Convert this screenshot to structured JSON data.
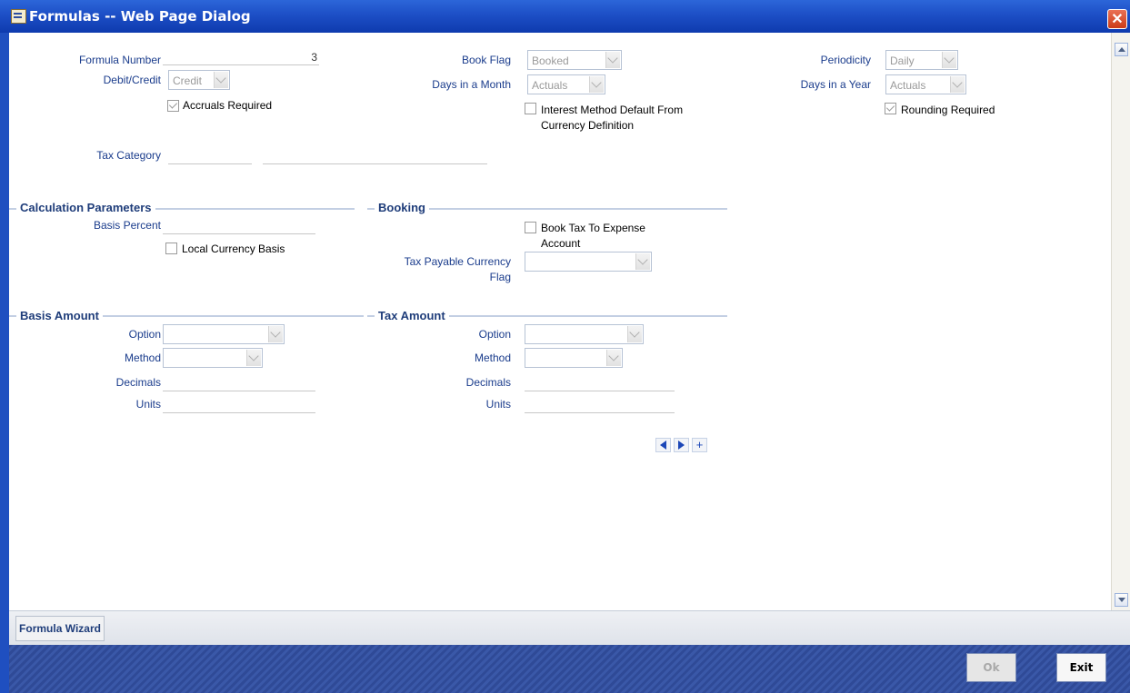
{
  "window": {
    "title": "Formulas -- Web Page Dialog",
    "close_glyph": "✕"
  },
  "fields": {
    "formula_number": {
      "label": "Formula Number",
      "value": "3"
    },
    "debit_credit": {
      "label": "Debit/Credit",
      "value": "Credit"
    },
    "accruals_required": {
      "label": "Accruals Required",
      "checked": true
    },
    "book_flag": {
      "label": "Book Flag",
      "value": "Booked"
    },
    "days_in_month": {
      "label": "Days in a Month",
      "value": "Actuals"
    },
    "interest_method_default": {
      "label_line1": "Interest Method Default From",
      "label_line2": "Currency Definition",
      "checked": false
    },
    "periodicity": {
      "label": "Periodicity",
      "value": "Daily"
    },
    "days_in_year": {
      "label": "Days in a Year",
      "value": "Actuals"
    },
    "rounding_required": {
      "label": "Rounding Required",
      "checked": true
    },
    "tax_category": {
      "label": "Tax Category",
      "value": "",
      "description": ""
    }
  },
  "calculation_parameters": {
    "heading": "Calculation Parameters",
    "basis_percent": {
      "label": "Basis Percent",
      "value": ""
    },
    "local_currency_basis": {
      "label": "Local Currency Basis",
      "checked": false
    }
  },
  "booking": {
    "heading": "Booking",
    "book_tax_to_expense": {
      "label_line1": "Book Tax To Expense",
      "label_line2": "Account",
      "checked": false
    },
    "tax_payable_currency_flag": {
      "label_line1": "Tax Payable Currency",
      "label_line2": "Flag",
      "value": ""
    }
  },
  "basis_amount": {
    "heading": "Basis Amount",
    "option_label": "Option",
    "option_value": "",
    "method_label": "Method",
    "method_value": "",
    "decimals_label": "Decimals",
    "decimals_value": "",
    "units_label": "Units",
    "units_value": ""
  },
  "tax_amount": {
    "heading": "Tax Amount",
    "option_label": "Option",
    "option_value": "",
    "method_label": "Method",
    "method_value": "",
    "decimals_label": "Decimals",
    "decimals_value": "",
    "units_label": "Units",
    "units_value": ""
  },
  "nav": {
    "prev_icon": "left-triangle",
    "next_icon": "right-triangle",
    "add_icon": "plus",
    "add_glyph": "+"
  },
  "tabs": {
    "formula_wizard": "Formula Wizard"
  },
  "footer": {
    "ok_label": "Ok",
    "exit_label": "Exit"
  },
  "colors": {
    "title_bar": "#1d4fc6",
    "label_text": "#1a3c8c",
    "section_rule": "#c3cfe3",
    "footer": "#2f4a97"
  }
}
